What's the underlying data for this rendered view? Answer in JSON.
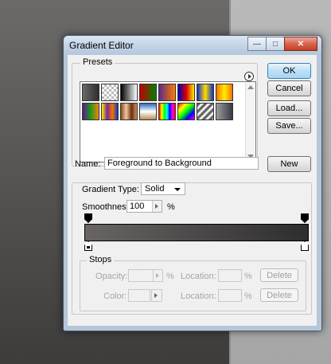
{
  "window": {
    "title": "Gradient Editor"
  },
  "presets": {
    "label": "Presets",
    "swatches": [
      {
        "name": "swatch-foreground-background",
        "bg": "linear-gradient(90deg,#6a6868,#2e2e2e)"
      },
      {
        "name": "swatch-fg-transparent",
        "bg": "repeating-conic-gradient(#bbb 0% 25%, #fff 0% 50%) 0 0/6px 6px"
      },
      {
        "name": "swatch-black-white",
        "bg": "linear-gradient(90deg,#000,#fff)"
      },
      {
        "name": "swatch-red-green",
        "bg": "linear-gradient(90deg,#c00000,#008000)"
      },
      {
        "name": "swatch-violet-orange",
        "bg": "linear-gradient(90deg,#5a2a88,#ff7a00)"
      },
      {
        "name": "swatch-blue-red-yellow",
        "bg": "linear-gradient(90deg,#0000c0,#d40000,#ffee00)"
      },
      {
        "name": "swatch-blue-yellow-blue",
        "bg": "linear-gradient(90deg,#1030c8,#ffdd00,#1030c8)"
      },
      {
        "name": "swatch-orange-yellow-orange",
        "bg": "linear-gradient(90deg,#ff7000,#ffee00,#ff7000)"
      },
      {
        "name": "swatch-violet-green-orange",
        "bg": "linear-gradient(90deg,#5a1a88,#1a9a1a,#ff8000)"
      },
      {
        "name": "swatch-yellow-violet-orange-blue",
        "bg": "linear-gradient(90deg,#ffee00,#7a2a9a,#ff7000,#0040c0)"
      },
      {
        "name": "swatch-copper",
        "bg": "linear-gradient(90deg,#8a4a1a,#f0c8a0,#6a3010,#d09060)"
      },
      {
        "name": "swatch-chrome",
        "bg": "linear-gradient(180deg,#2a6ab8,#fff 50%,#b89058)"
      },
      {
        "name": "swatch-spectrum",
        "bg": "linear-gradient(90deg,#ff0000,#ffff00,#00ff00,#00ffff,#0000ff,#ff00ff,#ff0000)"
      },
      {
        "name": "swatch-transparent-rainbow",
        "bg": "linear-gradient(135deg,#ff0000,#ffff00,#00ff00,#0000ff,#ff00ff)"
      },
      {
        "name": "swatch-transparent-stripes",
        "bg": "repeating-linear-gradient(135deg,#666 0 3px,#eee 3px 6px)"
      },
      {
        "name": "swatch-neutral-density",
        "bg": "linear-gradient(90deg,#9a9aa0,#3a3a44)"
      }
    ]
  },
  "buttons": {
    "ok": "OK",
    "cancel": "Cancel",
    "load": "Load...",
    "save": "Save...",
    "new": "New",
    "delete": "Delete"
  },
  "name": {
    "label": "Name:",
    "value": "Foreground to Background"
  },
  "gradient_type": {
    "label": "Gradient Type:",
    "value": "Solid",
    "smoothness_label": "Smoothness:",
    "smoothness_value": "100",
    "smoothness_unit": "%"
  },
  "stops": {
    "label": "Stops",
    "opacity_label": "Opacity:",
    "opacity_unit": "%",
    "location_label": "Location:",
    "location_unit": "%",
    "color_label": "Color:"
  }
}
